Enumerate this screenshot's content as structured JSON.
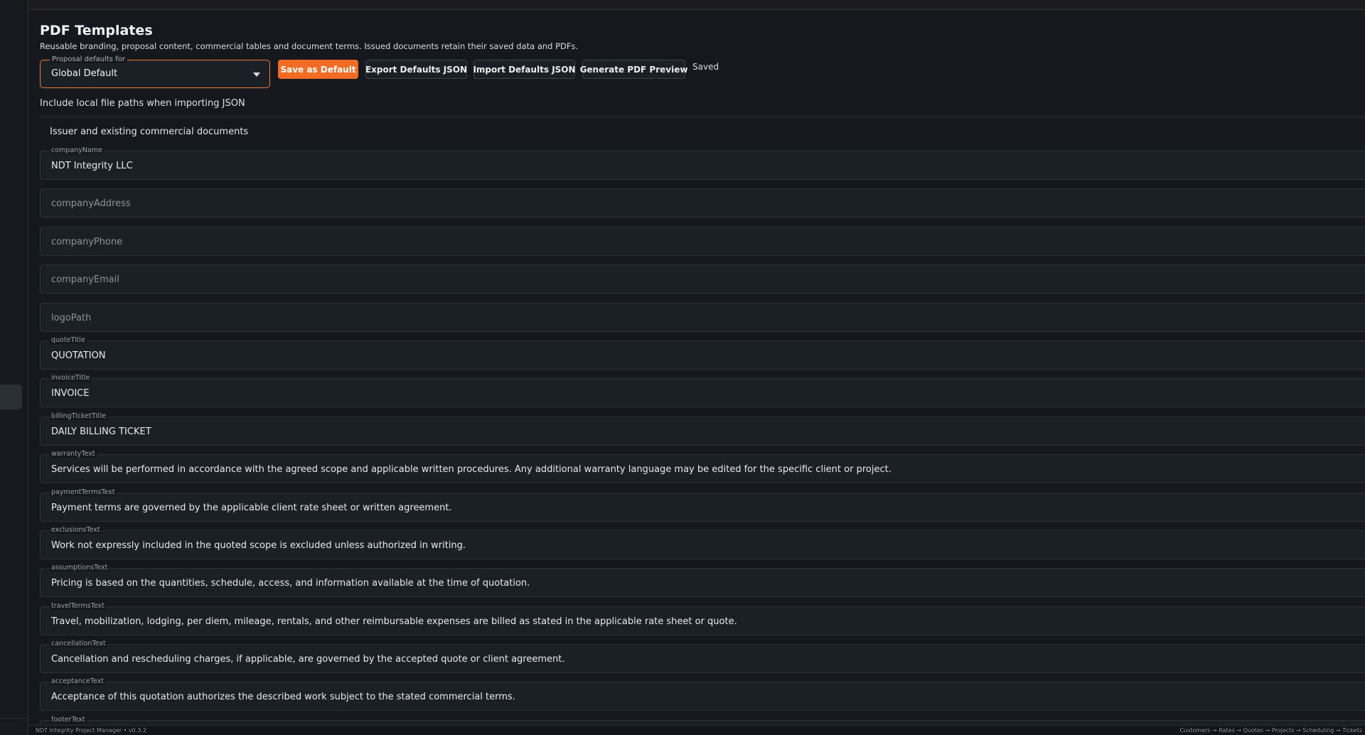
{
  "page": {
    "title": "PDF Templates",
    "subtitle": "Reusable branding, proposal content, commercial tables and document terms. Issued documents retain their saved data and PDFs."
  },
  "toolbar": {
    "select_label": "Proposal defaults for",
    "select_value": "Global Default",
    "save_default_label": "Save as Default",
    "export_label": "Export Defaults JSON",
    "import_label": "Import Defaults JSON",
    "preview_label": "Generate PDF Preview",
    "status": "Saved"
  },
  "import_option_label": "Include local file paths when importing JSON",
  "section_title": "Issuer and existing commercial documents",
  "fields": [
    {
      "label": "companyName",
      "value": "NDT Integrity LLC",
      "placeholder": ""
    },
    {
      "label": "",
      "value": "",
      "placeholder": "companyAddress"
    },
    {
      "label": "",
      "value": "",
      "placeholder": "companyPhone"
    },
    {
      "label": "",
      "value": "",
      "placeholder": "companyEmail"
    },
    {
      "label": "",
      "value": "",
      "placeholder": "logoPath"
    },
    {
      "label": "quoteTitle",
      "value": "QUOTATION",
      "placeholder": ""
    },
    {
      "label": "invoiceTitle",
      "value": "INVOICE",
      "placeholder": ""
    },
    {
      "label": "billingTicketTitle",
      "value": "DAILY BILLING TICKET",
      "placeholder": ""
    },
    {
      "label": "warrantyText",
      "value": "Services will be performed in accordance with the agreed scope and applicable written procedures. Any additional warranty language may be edited for the specific client or project.",
      "placeholder": ""
    },
    {
      "label": "paymentTermsText",
      "value": "Payment terms are governed by the applicable client rate sheet or written agreement.",
      "placeholder": ""
    },
    {
      "label": "exclusionsText",
      "value": "Work not expressly included in the quoted scope is excluded unless authorized in writing.",
      "placeholder": ""
    },
    {
      "label": "assumptionsText",
      "value": "Pricing is based on the quantities, schedule, access, and information available at the time of quotation.",
      "placeholder": ""
    },
    {
      "label": "travelTermsText",
      "value": "Travel, mobilization, lodging, per diem, mileage, rentals, and other reimbursable expenses are billed as stated in the applicable rate sheet or quote.",
      "placeholder": ""
    },
    {
      "label": "cancellationText",
      "value": "Cancellation and rescheduling charges, if applicable, are governed by the accepted quote or client agreement.",
      "placeholder": ""
    },
    {
      "label": "acceptanceText",
      "value": "Acceptance of this quotation authorizes the described work subject to the stated commercial terms.",
      "placeholder": ""
    },
    {
      "label": "footerText",
      "value": "",
      "placeholder": ""
    }
  ],
  "footer": {
    "app_name": "NDT Integrity Project Manager • v0.3.2",
    "workflow": "Customers → Rates → Quotes → Projects → Scheduling → Tickets"
  },
  "colors": {
    "accent": "#f36c24",
    "background": "#15191e",
    "field_background": "#1b2026"
  }
}
